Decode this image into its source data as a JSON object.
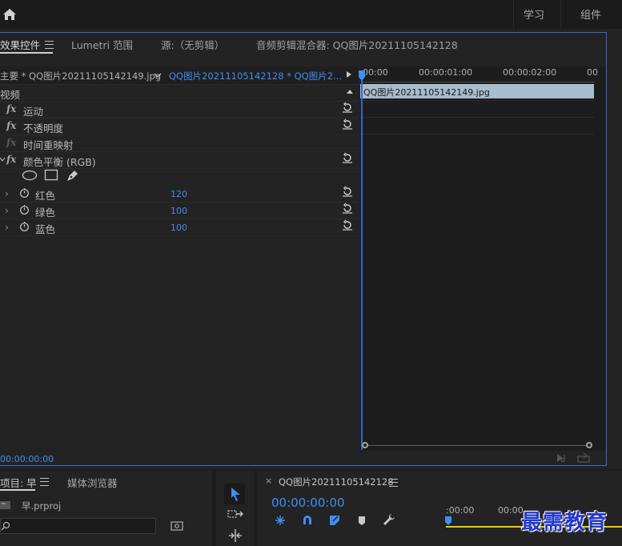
{
  "workspace": {
    "tabs": [
      "学习",
      "组件"
    ]
  },
  "panel": {
    "tabs": [
      "效果控件",
      "Lumetri 范围",
      "源:（无剪辑）",
      "音频剪辑混合器: QQ图片20211105142128"
    ]
  },
  "effect_controls": {
    "master_clip": "主要 * QQ图片20211105142149.jpg",
    "sequence_clip": "QQ图片20211105142128 * QQ图片2...",
    "section": "视频",
    "effects": [
      {
        "name": "运动"
      },
      {
        "name": "不透明度"
      },
      {
        "name": "时间重映射"
      },
      {
        "name": "颜色平衡 (RGB)"
      }
    ],
    "params": [
      {
        "name": "红色",
        "value": "120"
      },
      {
        "name": "绿色",
        "value": "100"
      },
      {
        "name": "蓝色",
        "value": "100"
      }
    ],
    "timecode": "00:00:00:00"
  },
  "timeline_mini": {
    "ruler": [
      "00:00",
      "00:00:01:00",
      "00:00:02:00",
      "00"
    ],
    "clip": "QQ图片20211105142149.jpg"
  },
  "project": {
    "tab": "项目: 早",
    "tab2": "媒体浏览器",
    "file": "早.prproj",
    "search_placeholder": ""
  },
  "sequence": {
    "name": "QQ图片20211105142128",
    "timecode": "00:00:00:00",
    "ruler": [
      ":00:00",
      "00:00"
    ]
  },
  "watermark": "最需教育",
  "colors": {
    "accent": "#2d6bd4",
    "value_blue": "#3f8ef5",
    "clip": "#a7bccd"
  }
}
